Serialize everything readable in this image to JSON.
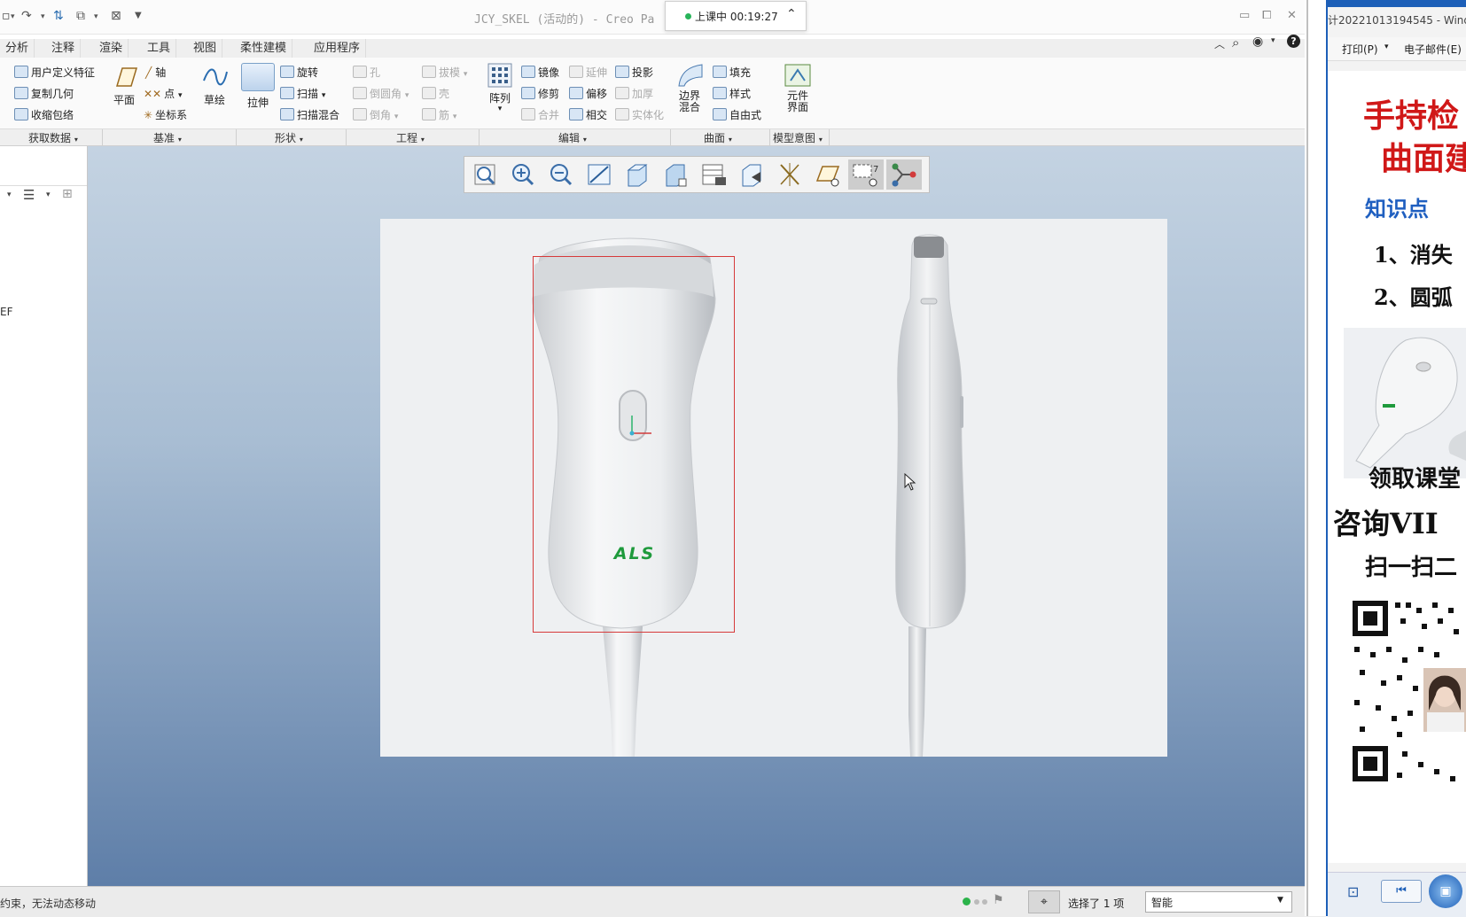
{
  "titlebar": {
    "title": "JCY_SKEL (活动的) - Creo Pa",
    "recording": {
      "label": "上课中 00:19:27"
    }
  },
  "ribbon": {
    "tabs": [
      "分析",
      "注释",
      "渲染",
      "工具",
      "视图",
      "柔性建模",
      "应用程序"
    ],
    "get_data": [
      "用户定义特征",
      "复制几何",
      "收缩包络"
    ],
    "datum": {
      "plane": "平面",
      "axis": "轴",
      "point": "点",
      "csys": "坐标系",
      "sketch": "草绘"
    },
    "shapes": {
      "extrude": "拉伸",
      "revolve": "旋转",
      "sweep": "扫描",
      "swept_blend": "扫描混合"
    },
    "engineering": {
      "hole": "孔",
      "round": "倒圆角",
      "chamfer": "倒角",
      "draft": "拔模",
      "shell": "壳",
      "rib": "筋"
    },
    "editing": {
      "pattern": "阵列",
      "mirror": "镜像",
      "trim": "修剪",
      "merge": "合并",
      "extend": "延伸",
      "offset": "偏移",
      "intersect": "相交",
      "project": "投影",
      "thicken": "加厚",
      "solidify": "实体化"
    },
    "surfaces": {
      "boundary_blend_1": "边界",
      "boundary_blend_2": "混合",
      "fill": "填充",
      "style": "样式",
      "freestyle": "自由式"
    },
    "model_intent": {
      "component_interface_1": "元件",
      "component_interface_2": "界面"
    },
    "groups": [
      "获取数据",
      "基准",
      "形状",
      "工程",
      "编辑",
      "曲面",
      "模型意图"
    ]
  },
  "left_panel": {
    "tree_item": "EF"
  },
  "canvas": {
    "logo": "ALS"
  },
  "statusbar": {
    "message": "约束，无法动态移动",
    "selection": "选择了 1 项",
    "filter": "智能"
  },
  "right_window": {
    "title": "计20221013194545 - Windo",
    "menu": [
      "打印(P)",
      "电子邮件(E)"
    ],
    "poster": {
      "line1": "手持检",
      "line2": "曲面建",
      "knowledge": "知识点",
      "point1": "1、消失",
      "point2": "2、圆弧",
      "claim": "领取课堂",
      "consult": "咨询VII",
      "scan": "扫一扫二"
    }
  },
  "colors": {
    "accent": "#1d5fb8",
    "selection": "#d63a3a",
    "logo": "#1e9a3c",
    "poster_red": "#d01818",
    "poster_blue": "#1f5fc0"
  }
}
